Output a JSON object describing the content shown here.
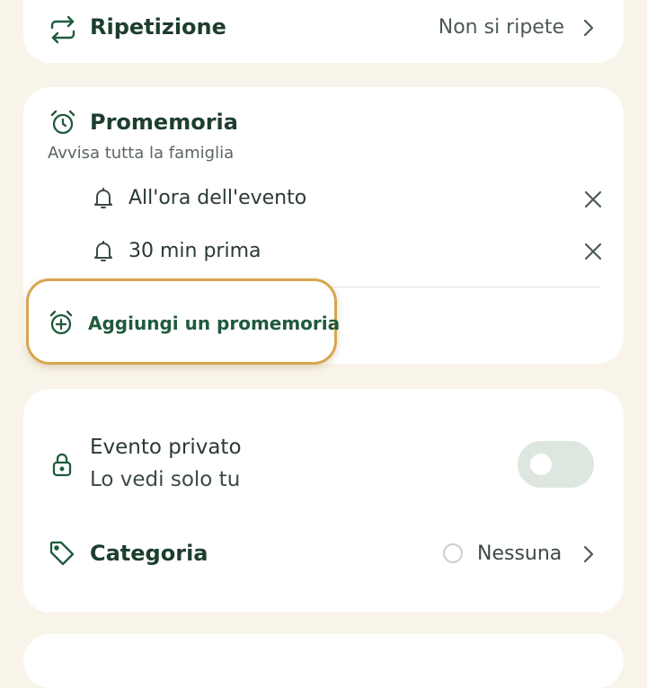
{
  "repeat": {
    "label": "Ripetizione",
    "value": "Non si ripete",
    "icon": "repeat-icon"
  },
  "reminders": {
    "title": "Promemoria",
    "subtitle": "Avvisa tutta la famiglia",
    "items": [
      {
        "label": "All'ora dell'evento",
        "icon": "bell-icon"
      },
      {
        "label": "30 min prima",
        "icon": "bell-icon"
      }
    ],
    "add_label": "Aggiungi un promemoria"
  },
  "privacy": {
    "label": "Evento privato",
    "sublabel": "Lo vedi solo tu",
    "enabled": false
  },
  "category": {
    "label": "Categoria",
    "value": "Nessuna"
  },
  "colors": {
    "background": "#f8f4ea",
    "card": "#ffffff",
    "accent": "#1f5a3c",
    "highlight": "#d8a650",
    "toggle_off": "#dde6df"
  }
}
